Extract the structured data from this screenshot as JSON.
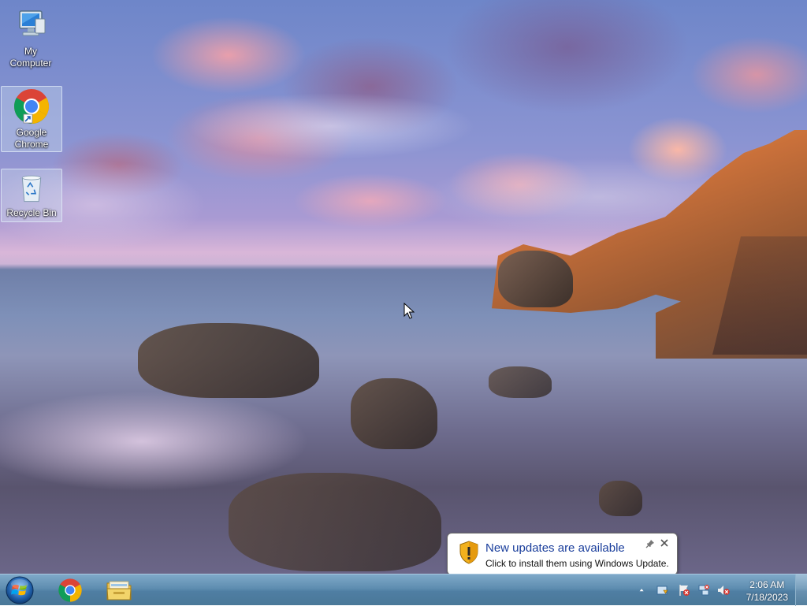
{
  "desktop": {
    "icons": [
      {
        "label": "My Computer"
      },
      {
        "label": "Google Chrome"
      },
      {
        "label": "Recycle Bin"
      }
    ]
  },
  "taskbar": {
    "pinned": [
      "Google Chrome",
      "Windows Explorer"
    ],
    "clock": {
      "time": "2:06 AM",
      "date": "7/18/2023"
    }
  },
  "notification": {
    "title": "New updates are available",
    "message": "Click to install them using Windows Update."
  },
  "colors": {
    "taskbar": "#5e8db0",
    "notification_title": "#1a3e9c"
  }
}
